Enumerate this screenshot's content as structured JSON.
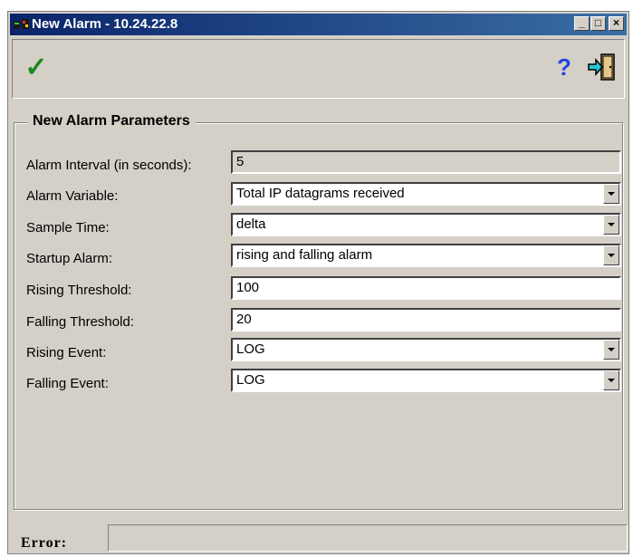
{
  "window": {
    "title": "New Alarm - 10.24.22.8",
    "controls": {
      "minimize": "_",
      "maximize": "□",
      "close": "×"
    }
  },
  "toolbar": {
    "ok_icon": "checkmark-icon",
    "help_icon": "help-icon",
    "exit_icon": "exit-door-icon",
    "ok_glyph": "✓",
    "help_glyph": "?"
  },
  "form": {
    "group_title": "New Alarm Parameters",
    "fields": [
      {
        "label": "Alarm Interval (in seconds):",
        "value": "5",
        "type": "readonly"
      },
      {
        "label": "Alarm Variable:",
        "value": "Total IP datagrams received",
        "type": "select"
      },
      {
        "label": "Sample Time:",
        "value": "delta",
        "type": "select"
      },
      {
        "label": "Startup Alarm:",
        "value": "rising and falling alarm",
        "type": "select"
      },
      {
        "label": "Rising Threshold:",
        "value": "100",
        "type": "text"
      },
      {
        "label": "Falling Threshold:",
        "value": "20",
        "type": "text"
      },
      {
        "label": "Rising Event:",
        "value": "LOG",
        "type": "select"
      },
      {
        "label": "Falling Event:",
        "value": "LOG",
        "type": "select"
      }
    ]
  },
  "status": {
    "error_label": "Error:",
    "error_value": ""
  },
  "colors": {
    "titlebar_start": "#0a246a",
    "titlebar_end": "#3a6ea5",
    "face": "#d4d0c8",
    "ok_green": "#1a8a1a",
    "help_blue": "#2244dd"
  }
}
